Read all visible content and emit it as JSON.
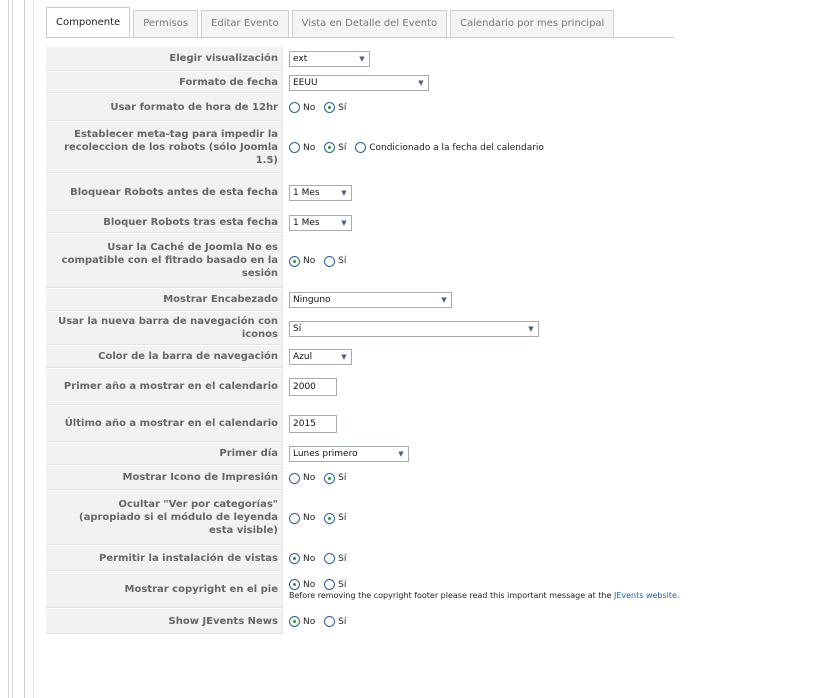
{
  "tabs": [
    "Componente",
    "Permisos",
    "Editar Evento",
    "Vista en Detalle del Evento",
    "Calendario por mes principal"
  ],
  "colors": {
    "link": "#1a5fb4",
    "radio_checked": "#1d9a2f"
  },
  "fields": {
    "visualizacion": {
      "label": "Elegir visualización",
      "value": "ext"
    },
    "formato_fecha": {
      "label": "Formato de fecha",
      "value": "EEUU"
    },
    "formato_12hr": {
      "label": "Usar formato de hora de 12hr",
      "options": [
        "No",
        "Sí"
      ],
      "selected": "Sí"
    },
    "meta_tag": {
      "label": "Establecer meta-tag para impedir la recoleccion de los robots (sólo Joomla 1.5)",
      "options": [
        "No",
        "Sí",
        "Condicionado a la fecha del calendario"
      ],
      "selected": "Sí"
    },
    "bloquear_antes": {
      "label": "Bloquear Robots antes de esta fecha",
      "value": "1 Mes"
    },
    "bloquear_tras": {
      "label": "Bloquer Robots tras esta fecha",
      "value": "1 Mes"
    },
    "cache": {
      "label": "Usar la Caché de Joomla No es compatible con el fitrado basado en la sesión",
      "options": [
        "No",
        "Sí"
      ],
      "selected": "No"
    },
    "encabezado": {
      "label": "Mostrar Encabezado",
      "value": "Ninguno"
    },
    "nueva_barra": {
      "label": "Usar la nueva barra de navegación con iconos",
      "value": "Sí"
    },
    "color_barra": {
      "label": "Color de la barra de navegación",
      "value": "Azul"
    },
    "primer_anio": {
      "label": "Primer año a mostrar en el calendario",
      "value": "2000"
    },
    "ultimo_anio": {
      "label": "Último año a mostrar en el calendario",
      "value": "2015"
    },
    "primer_dia": {
      "label": "Primer día",
      "value": "Lunes primero"
    },
    "icono_impresion": {
      "label": "Mostrar Icono de Impresión",
      "options": [
        "No",
        "Sí"
      ],
      "selected": "Sí"
    },
    "ver_categorias": {
      "label": "Ocultar \"Ver por categorías\" (apropiado si el módulo de leyenda esta visible)",
      "options": [
        "No",
        "Sí"
      ],
      "selected": "Sí"
    },
    "instalacion_vistas": {
      "label": "Permitir la instalación de vistas",
      "options": [
        "No",
        "Sí"
      ],
      "selected": "No"
    },
    "copyright": {
      "label": "Mostrar copyright en el pie",
      "options": [
        "No",
        "Sí"
      ],
      "selected": "No",
      "note_text": "Before removing the copyright footer please read this important message at the",
      "note_link": "JEvents website."
    },
    "news": {
      "label": "Show JEvents News",
      "options": [
        "No",
        "Sí"
      ],
      "selected": "No"
    }
  }
}
